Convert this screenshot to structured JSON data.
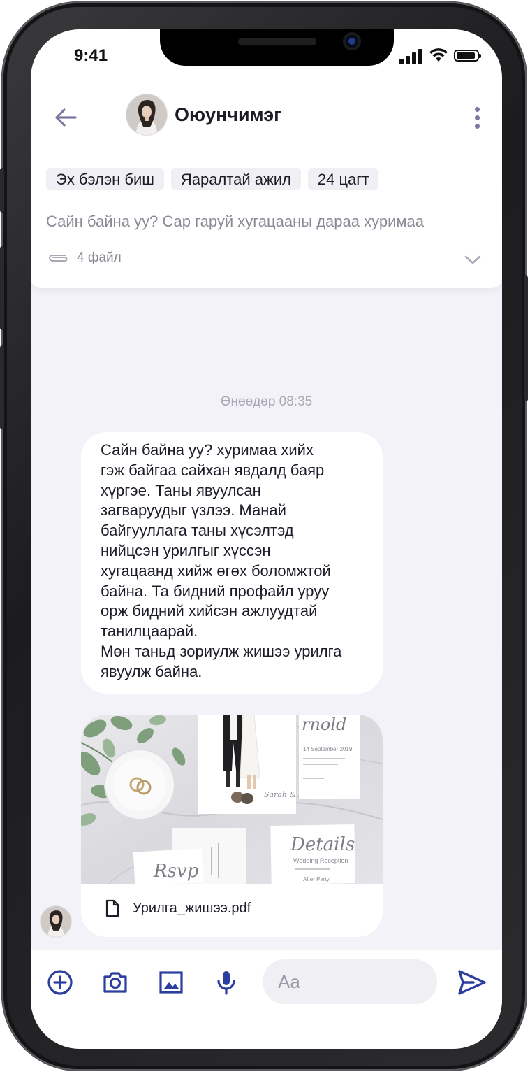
{
  "status_bar": {
    "time": "9:41"
  },
  "header": {
    "contact_name": "Оюунчимэг",
    "tags": [
      "Эх бэлэн биш",
      "Яаралтай ажил",
      "24 цагт"
    ],
    "preview_text": "Сайн байна уу?  Сар гаруй хугацааны дараа хуримаа",
    "file_count": "4 файл"
  },
  "chat": {
    "date_label": "Өнөөдөр 08:35",
    "message": "Сайн байна уу? хуримаа хийх\nгэж байгаа сайхан явдалд баяр\nхүргэе. Таны явуулсан\nзагваруудыг үзлээ. Манай\nбайгууллага таны хүсэлтэд\nнийцсэн урилгыг хүссэн\nхугацаанд хийж өгөх боломжтой\nбайна. Та бидний профайл уруу\nорж бидний хийсэн ажлуудтай\nтанилцаарай.\nМөн таньд зориулж жишээ урилга\nявуулж байна.",
    "attachment": {
      "file_name": "Урилга_жишээ.pdf",
      "photo_text": {
        "name_partial": "rnold",
        "date_line": "14 September 2019",
        "couple": "Sarah & Arnold",
        "details": "Details",
        "reception": "Wedding Reception",
        "after": "After Party",
        "rsvp": "Rsvp"
      }
    }
  },
  "input_bar": {
    "placeholder": "Aa"
  },
  "colors": {
    "accent": "#2c3e9e",
    "secondary_icon": "#7a77a0",
    "chat_bg": "#f2f2f8"
  },
  "icons": [
    "back-arrow-icon",
    "more-vertical-icon",
    "paperclip-icon",
    "chevron-down-icon",
    "file-icon",
    "plus-circle-icon",
    "camera-icon",
    "image-icon",
    "microphone-icon",
    "send-icon"
  ]
}
